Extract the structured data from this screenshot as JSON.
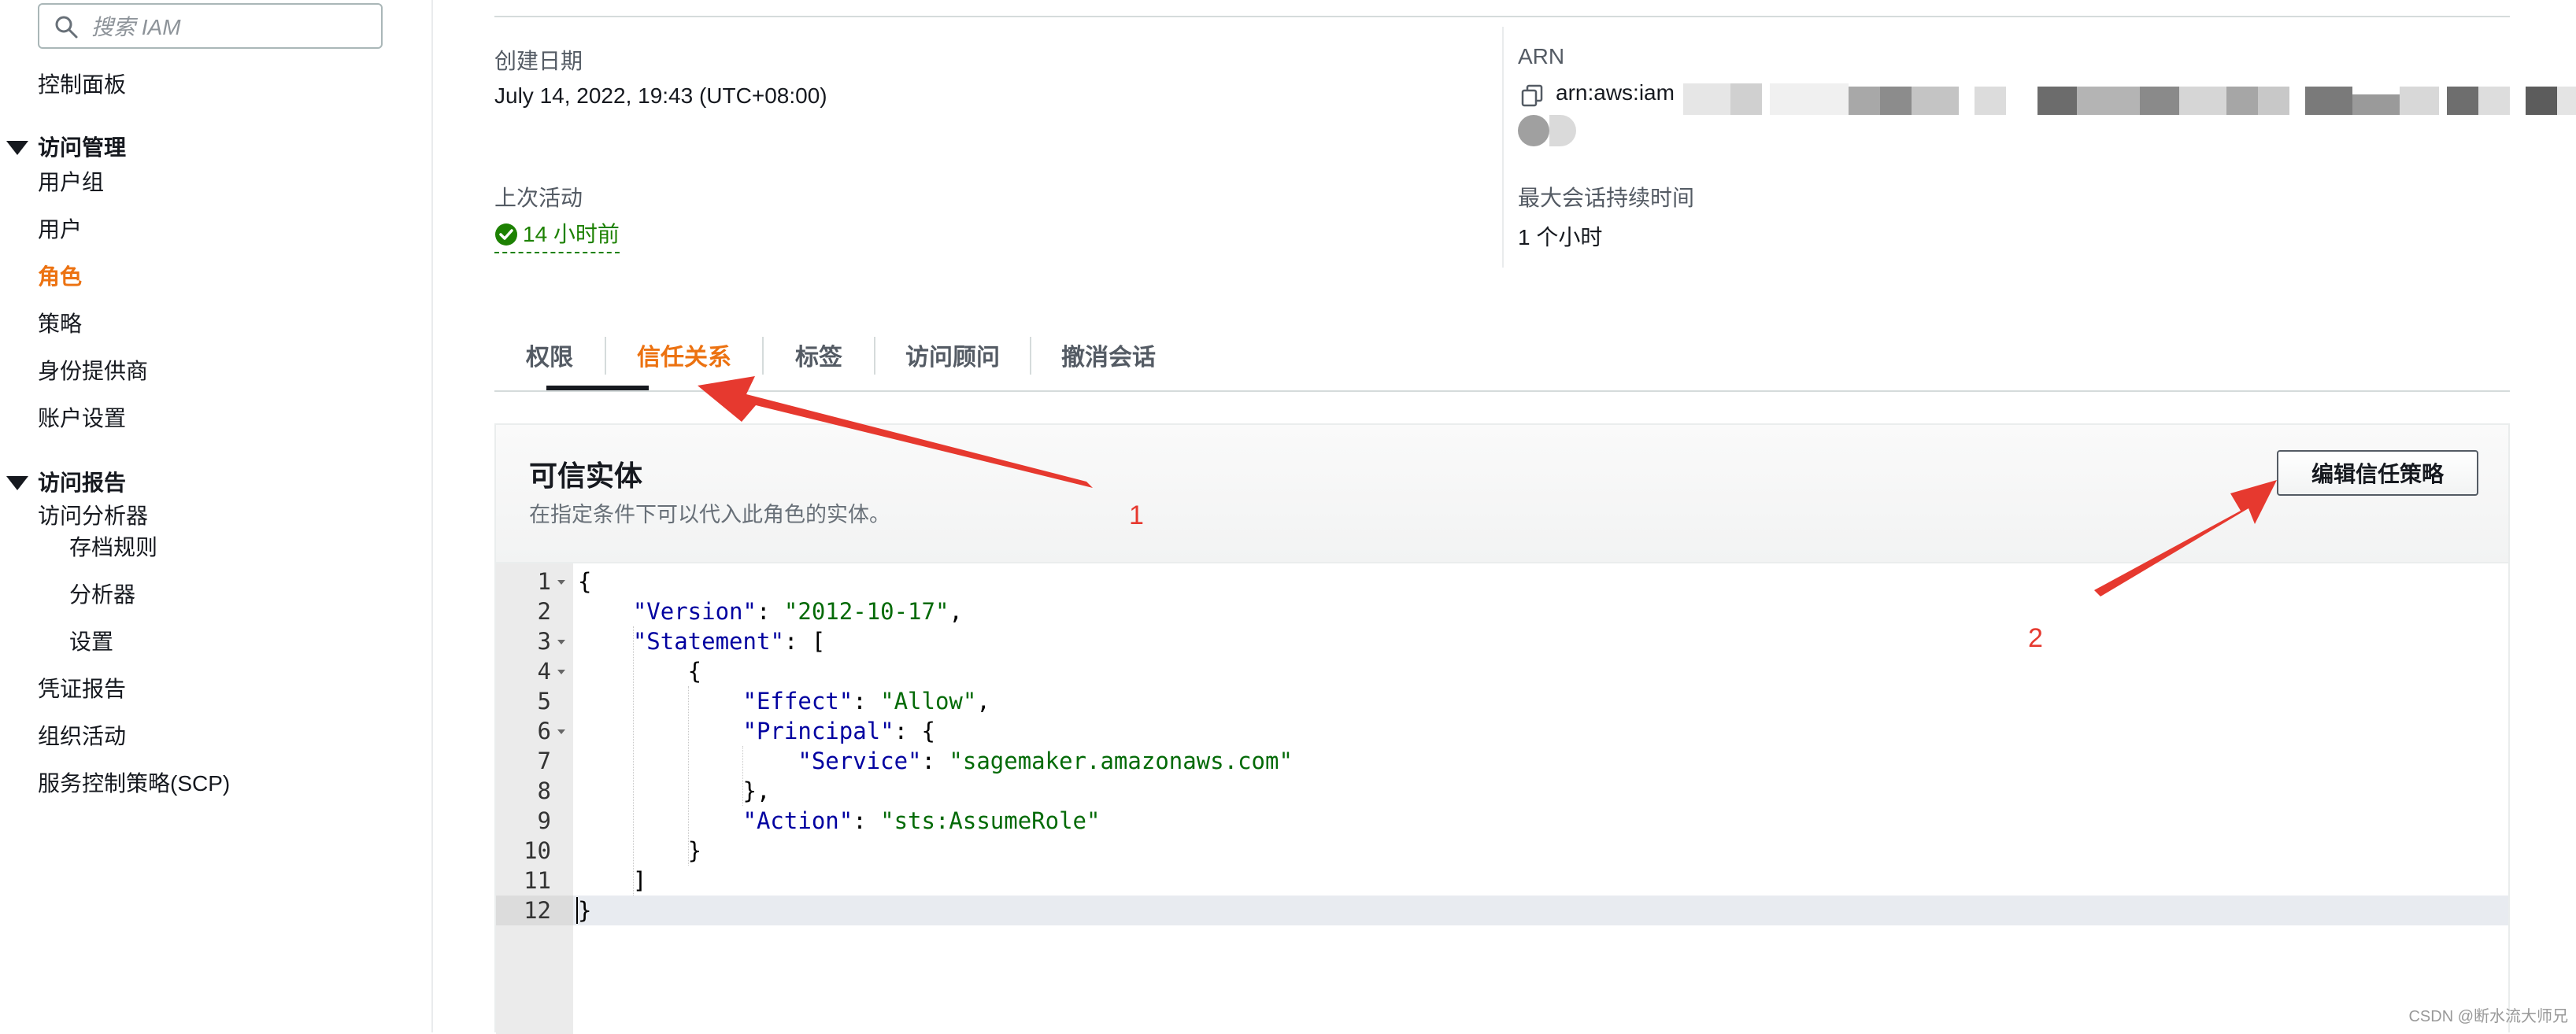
{
  "sidebar": {
    "search_placeholder": "搜索 IAM",
    "dashboard": "控制面板",
    "access_management": {
      "title": "访问管理",
      "items": [
        "用户组",
        "用户",
        "角色",
        "策略",
        "身份提供商",
        "账户设置"
      ],
      "active": "角色"
    },
    "access_reports": {
      "title": "访问报告",
      "items": [
        "访问分析器",
        "存档规则",
        "分析器",
        "设置",
        "凭证报告",
        "组织活动",
        "服务控制策略(SCP)"
      ]
    }
  },
  "summary": {
    "created_label": "创建日期",
    "created_value": "July 14, 2022, 19:43 (UTC+08:00)",
    "arn_label": "ARN",
    "arn_value": "arn:aws:iam",
    "last_activity_label": "上次活动",
    "last_activity_value": "14 小时前",
    "max_session_label": "最大会话持续时间",
    "max_session_value": "1 个小时"
  },
  "tabs": [
    "权限",
    "信任关系",
    "标签",
    "访问顾问",
    "撤消会话"
  ],
  "active_tab": "信任关系",
  "trusted_entities": {
    "title": "可信实体",
    "description": "在指定条件下可以代入此角色的实体。",
    "edit_button": "编辑信任策略"
  },
  "policy_lines": [
    "{",
    "    \"Version\": \"2012-10-17\",",
    "    \"Statement\": [",
    "        {",
    "            \"Effect\": \"Allow\",",
    "            \"Principal\": {",
    "                \"Service\": \"sagemaker.amazonaws.com\"",
    "            },",
    "            \"Action\": \"sts:AssumeRole\"",
    "        }",
    "    ]",
    "}"
  ],
  "annotations": {
    "arrow_1_label": "1",
    "arrow_2_label": "2"
  },
  "colors": {
    "accent": "#ec7211",
    "success": "#1d8102",
    "annotation": "#e6392f"
  },
  "watermark": "CSDN @断水流大师兄"
}
